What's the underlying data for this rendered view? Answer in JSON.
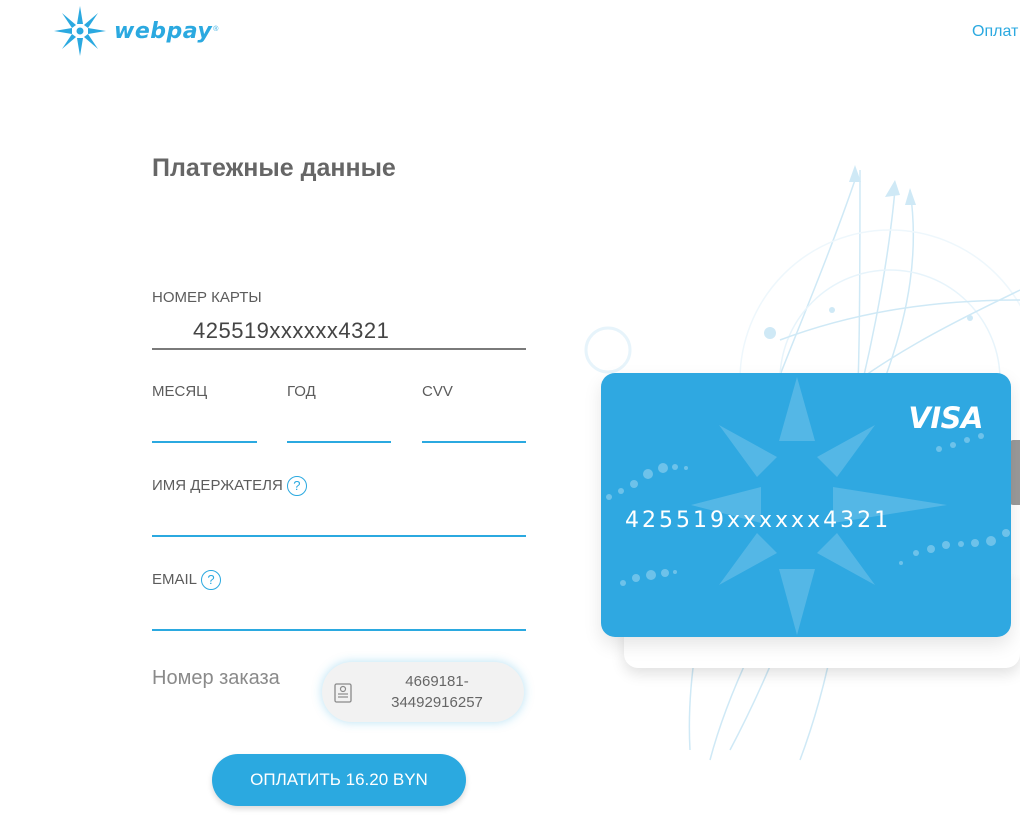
{
  "header": {
    "logo_text": "webpay",
    "logo_reg": "®",
    "nav_link": "Оплат"
  },
  "form": {
    "title": "Платежные данные",
    "card_number_label": "НОМЕР КАРТЫ",
    "card_number_value": "425519xxxxxx4321",
    "month_label": "МЕСЯЦ",
    "year_label": "ГОД",
    "cvv_label": "CVV",
    "holder_label": "ИМЯ ДЕРЖАТЕЛЯ",
    "email_label": "EMAIL",
    "help_glyph": "?",
    "order_label": "Номер заказа",
    "order_number_line1": "4669181-",
    "order_number_line2": "34492916257",
    "pay_button_label": "ОПЛАТИТЬ 16.20 BYN"
  },
  "card": {
    "brand": "VISA",
    "number": "425519xxxxxx4321"
  },
  "colors": {
    "accent": "#2ba9e0",
    "card": "#2fa8e1"
  }
}
